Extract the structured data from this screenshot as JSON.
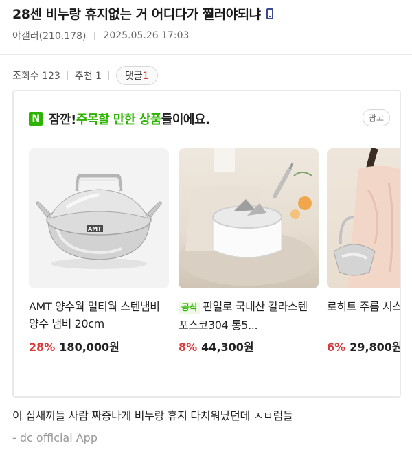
{
  "post": {
    "title": "28센 비누랑 휴지없는 거 어디다가 찔러야되냐",
    "title_icon": "phone-icon",
    "author": "야갤러(210.178)",
    "date": "2025.05.26 17:03",
    "views_label": "조회수 123",
    "recommend_label": "추천 1",
    "comments_label": "댓글",
    "comments_count": "1",
    "body": "이 십새끼들 사람 짜증나게 비누랑 휴지 다치워났던데 ㅅㅂ럼들",
    "signature": "- dc official App"
  },
  "ad": {
    "logo_letter": "N",
    "header_prefix": "잠깐! ",
    "header_highlight": "주목할 만한 상품",
    "header_suffix": "들이에요.",
    "badge": "광고",
    "brand_color": "#2db400",
    "products": [
      {
        "name": "AMT 양수웍 멀티웍 스텐냄비 양수 냄비 20cm",
        "official": "",
        "discount": "28%",
        "price": "180,000원",
        "image_icon": "stainless-pot-image"
      },
      {
        "name": "핀일로 국내산 칼라스텐 포스코304 통5...",
        "official": "공식",
        "discount": "8%",
        "price": "44,300원",
        "image_icon": "milk-pan-image"
      },
      {
        "name": "로히트 주름 시스루 블라우",
        "official": "",
        "discount": "6%",
        "price": "29,800원",
        "image_icon": "blouse-bag-image"
      }
    ]
  },
  "colors": {
    "discount": "#d93b3b",
    "comment_count": "#d93b3b"
  }
}
